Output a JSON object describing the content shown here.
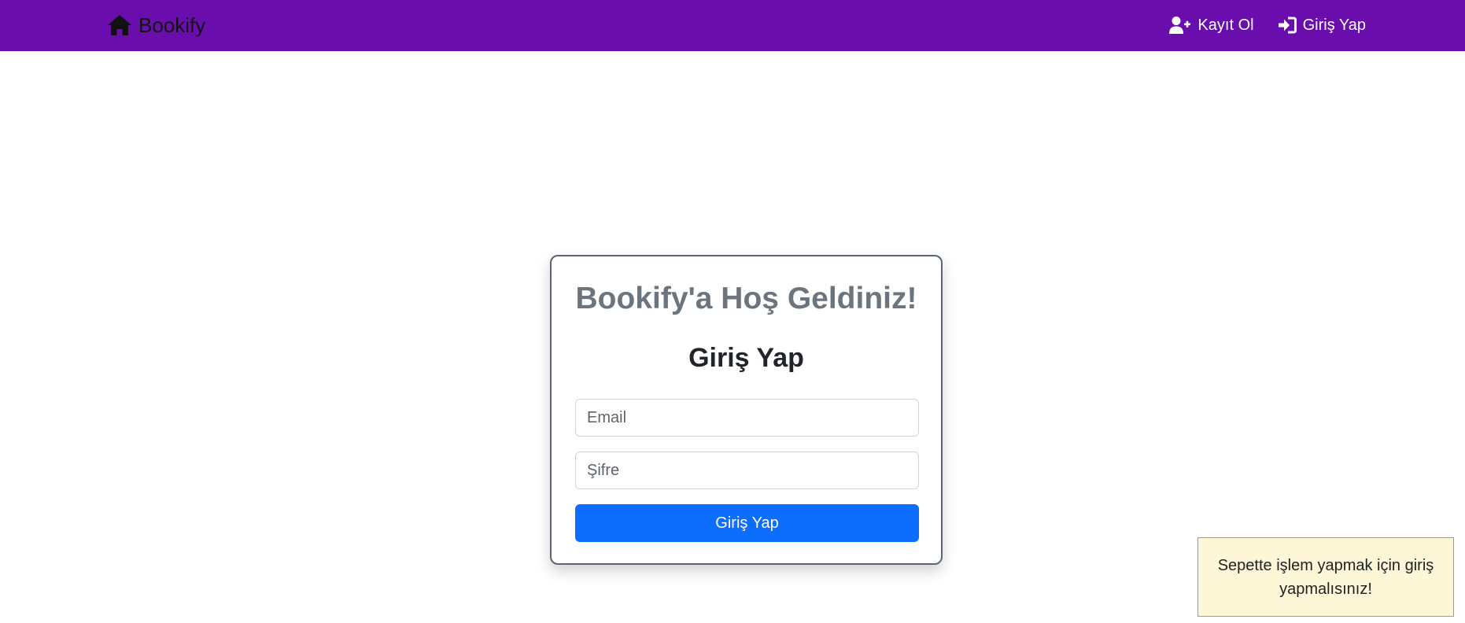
{
  "navbar": {
    "brand": "Bookify",
    "brand_icon": "home-icon",
    "register_label": "Kayıt Ol",
    "register_icon": "user-plus-icon",
    "login_label": "Giriş Yap",
    "login_icon": "sign-in-icon",
    "background_color": "#6a0dad"
  },
  "login_card": {
    "welcome": "Bookify'a Hoş Geldiniz!",
    "title": "Giriş Yap",
    "email_placeholder": "Email",
    "email_value": "",
    "password_placeholder": "Şifre",
    "password_value": "",
    "submit_label": "Giriş Yap",
    "submit_color": "#0d6efd"
  },
  "toast": {
    "message": "Sepette işlem yapmak için giriş yapmalısınız!",
    "background_color": "#fdf7d8"
  }
}
